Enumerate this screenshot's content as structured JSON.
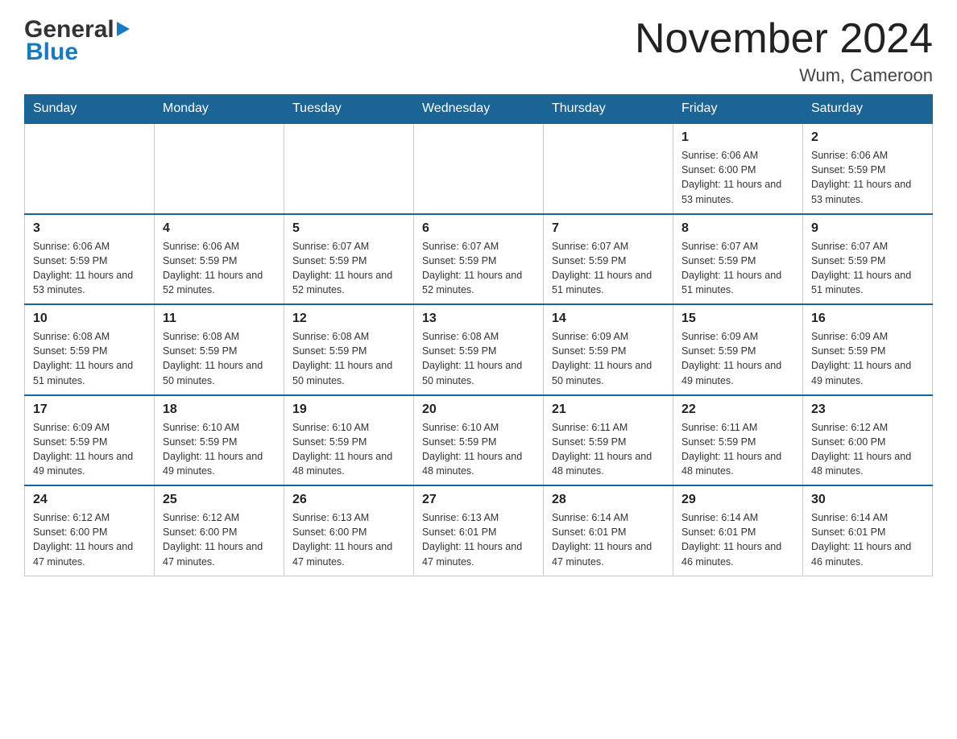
{
  "header": {
    "logo_general": "General",
    "logo_blue": "Blue",
    "month_year": "November 2024",
    "location": "Wum, Cameroon"
  },
  "days_of_week": [
    "Sunday",
    "Monday",
    "Tuesday",
    "Wednesday",
    "Thursday",
    "Friday",
    "Saturday"
  ],
  "weeks": [
    {
      "cells": [
        {
          "day": "",
          "info": ""
        },
        {
          "day": "",
          "info": ""
        },
        {
          "day": "",
          "info": ""
        },
        {
          "day": "",
          "info": ""
        },
        {
          "day": "",
          "info": ""
        },
        {
          "day": "1",
          "info": "Sunrise: 6:06 AM\nSunset: 6:00 PM\nDaylight: 11 hours and 53 minutes."
        },
        {
          "day": "2",
          "info": "Sunrise: 6:06 AM\nSunset: 5:59 PM\nDaylight: 11 hours and 53 minutes."
        }
      ]
    },
    {
      "cells": [
        {
          "day": "3",
          "info": "Sunrise: 6:06 AM\nSunset: 5:59 PM\nDaylight: 11 hours and 53 minutes."
        },
        {
          "day": "4",
          "info": "Sunrise: 6:06 AM\nSunset: 5:59 PM\nDaylight: 11 hours and 52 minutes."
        },
        {
          "day": "5",
          "info": "Sunrise: 6:07 AM\nSunset: 5:59 PM\nDaylight: 11 hours and 52 minutes."
        },
        {
          "day": "6",
          "info": "Sunrise: 6:07 AM\nSunset: 5:59 PM\nDaylight: 11 hours and 52 minutes."
        },
        {
          "day": "7",
          "info": "Sunrise: 6:07 AM\nSunset: 5:59 PM\nDaylight: 11 hours and 51 minutes."
        },
        {
          "day": "8",
          "info": "Sunrise: 6:07 AM\nSunset: 5:59 PM\nDaylight: 11 hours and 51 minutes."
        },
        {
          "day": "9",
          "info": "Sunrise: 6:07 AM\nSunset: 5:59 PM\nDaylight: 11 hours and 51 minutes."
        }
      ]
    },
    {
      "cells": [
        {
          "day": "10",
          "info": "Sunrise: 6:08 AM\nSunset: 5:59 PM\nDaylight: 11 hours and 51 minutes."
        },
        {
          "day": "11",
          "info": "Sunrise: 6:08 AM\nSunset: 5:59 PM\nDaylight: 11 hours and 50 minutes."
        },
        {
          "day": "12",
          "info": "Sunrise: 6:08 AM\nSunset: 5:59 PM\nDaylight: 11 hours and 50 minutes."
        },
        {
          "day": "13",
          "info": "Sunrise: 6:08 AM\nSunset: 5:59 PM\nDaylight: 11 hours and 50 minutes."
        },
        {
          "day": "14",
          "info": "Sunrise: 6:09 AM\nSunset: 5:59 PM\nDaylight: 11 hours and 50 minutes."
        },
        {
          "day": "15",
          "info": "Sunrise: 6:09 AM\nSunset: 5:59 PM\nDaylight: 11 hours and 49 minutes."
        },
        {
          "day": "16",
          "info": "Sunrise: 6:09 AM\nSunset: 5:59 PM\nDaylight: 11 hours and 49 minutes."
        }
      ]
    },
    {
      "cells": [
        {
          "day": "17",
          "info": "Sunrise: 6:09 AM\nSunset: 5:59 PM\nDaylight: 11 hours and 49 minutes."
        },
        {
          "day": "18",
          "info": "Sunrise: 6:10 AM\nSunset: 5:59 PM\nDaylight: 11 hours and 49 minutes."
        },
        {
          "day": "19",
          "info": "Sunrise: 6:10 AM\nSunset: 5:59 PM\nDaylight: 11 hours and 48 minutes."
        },
        {
          "day": "20",
          "info": "Sunrise: 6:10 AM\nSunset: 5:59 PM\nDaylight: 11 hours and 48 minutes."
        },
        {
          "day": "21",
          "info": "Sunrise: 6:11 AM\nSunset: 5:59 PM\nDaylight: 11 hours and 48 minutes."
        },
        {
          "day": "22",
          "info": "Sunrise: 6:11 AM\nSunset: 5:59 PM\nDaylight: 11 hours and 48 minutes."
        },
        {
          "day": "23",
          "info": "Sunrise: 6:12 AM\nSunset: 6:00 PM\nDaylight: 11 hours and 48 minutes."
        }
      ]
    },
    {
      "cells": [
        {
          "day": "24",
          "info": "Sunrise: 6:12 AM\nSunset: 6:00 PM\nDaylight: 11 hours and 47 minutes."
        },
        {
          "day": "25",
          "info": "Sunrise: 6:12 AM\nSunset: 6:00 PM\nDaylight: 11 hours and 47 minutes."
        },
        {
          "day": "26",
          "info": "Sunrise: 6:13 AM\nSunset: 6:00 PM\nDaylight: 11 hours and 47 minutes."
        },
        {
          "day": "27",
          "info": "Sunrise: 6:13 AM\nSunset: 6:01 PM\nDaylight: 11 hours and 47 minutes."
        },
        {
          "day": "28",
          "info": "Sunrise: 6:14 AM\nSunset: 6:01 PM\nDaylight: 11 hours and 47 minutes."
        },
        {
          "day": "29",
          "info": "Sunrise: 6:14 AM\nSunset: 6:01 PM\nDaylight: 11 hours and 46 minutes."
        },
        {
          "day": "30",
          "info": "Sunrise: 6:14 AM\nSunset: 6:01 PM\nDaylight: 11 hours and 46 minutes."
        }
      ]
    }
  ]
}
